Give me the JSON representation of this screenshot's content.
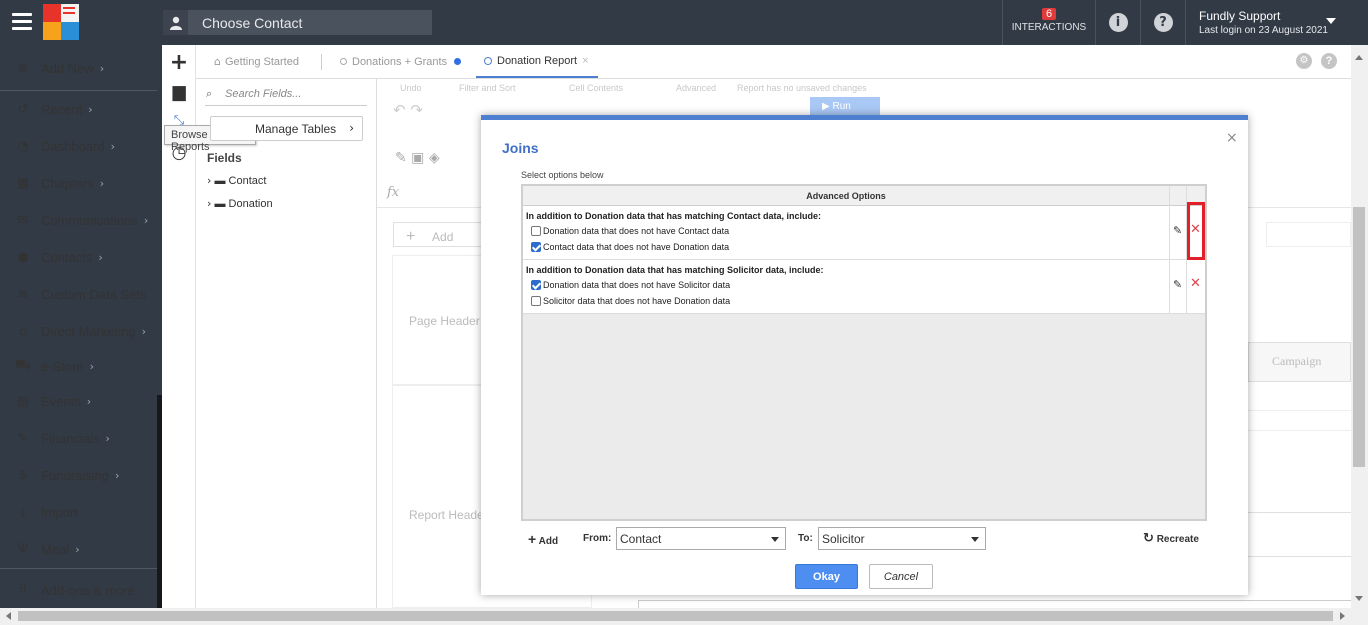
{
  "topbar": {
    "contact_label": "Choose Contact",
    "interactions_count": "6",
    "interactions_label": "INTERACTIONS",
    "user_name": "Fundly Support",
    "last_login": "Last login on 23 August 2021"
  },
  "sidebar": {
    "items": [
      {
        "label": "Add New",
        "icon": "plus-circle-icon"
      },
      {
        "label": "Recent",
        "icon": "history-icon"
      },
      {
        "label": "Dashboard",
        "icon": "dashboard-icon"
      },
      {
        "label": "Chapters",
        "icon": "grid-icon"
      },
      {
        "label": "Communications",
        "icon": "envelope-icon"
      },
      {
        "label": "Contacts",
        "icon": "person-icon"
      },
      {
        "label": "Custom Data Sets",
        "icon": "database-icon"
      },
      {
        "label": "Direct Marketing",
        "icon": "bank-icon"
      },
      {
        "label": "e-Store",
        "icon": "cart-icon"
      },
      {
        "label": "Events",
        "icon": "calendar-icon"
      },
      {
        "label": "Financials",
        "icon": "money-icon"
      },
      {
        "label": "Fundraising",
        "icon": "money-bag-icon"
      },
      {
        "label": "Import",
        "icon": "download-icon"
      },
      {
        "label": "Meal",
        "icon": "cutlery-icon"
      },
      {
        "label": "Add-ons & more",
        "icon": "apps-icon"
      }
    ]
  },
  "strip": {
    "tooltip": "Browse Reports"
  },
  "tabs": [
    {
      "label": "Getting Started"
    },
    {
      "label": "Donations + Grants"
    },
    {
      "label": "Donation Report"
    }
  ],
  "fields": {
    "search_placeholder": "Search Fields...",
    "manage_tables": "Manage Tables",
    "heading": "Fields",
    "tree": [
      "Contact",
      "Donation"
    ]
  },
  "toolbar": {
    "groups": [
      "Undo",
      "Filter and Sort",
      "Cell Contents",
      "Advanced",
      "Report has no unsaved changes"
    ],
    "run": "Run"
  },
  "designer": {
    "page_header": "Page Header",
    "report_header": "Report Heade",
    "add": "Add",
    "campaign": "Campaign",
    "fx": "fx"
  },
  "modal": {
    "title": "Joins",
    "subtitle": "Select options below",
    "grid_header": "Advanced Options",
    "rows": [
      {
        "heading": "In addition to Donation data that has matching Contact data, include:",
        "options": [
          {
            "label": "Donation data that does not have Contact data",
            "checked": false
          },
          {
            "label": "Contact data that does not have Donation data",
            "checked": true
          }
        ]
      },
      {
        "heading": "In addition to Donation data that has matching Solicitor data, include:",
        "options": [
          {
            "label": "Donation data that does not have Solicitor data",
            "checked": true
          },
          {
            "label": "Solicitor data that does not have Donation data",
            "checked": false
          }
        ]
      }
    ],
    "add": "Add",
    "from_label": "From:",
    "from_value": "Contact",
    "to_label": "To:",
    "to_value": "Solicitor",
    "recreate": "Recreate",
    "okay": "Okay",
    "cancel": "Cancel"
  }
}
